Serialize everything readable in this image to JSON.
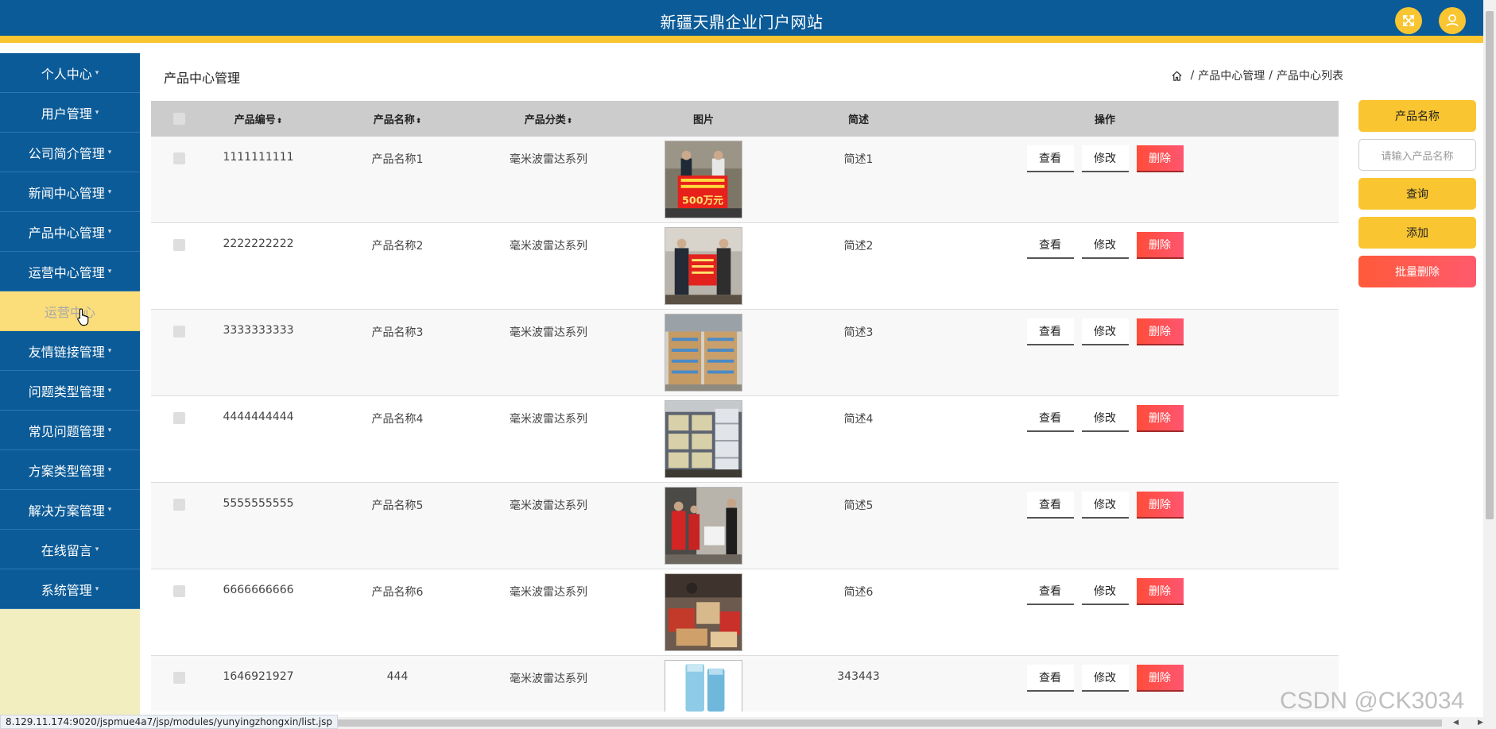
{
  "header": {
    "title": "新疆天鼎企业门户网站",
    "icons": [
      "fullscreen-icon",
      "user-icon"
    ],
    "accent": "#f9c531",
    "primary": "#0b5b98"
  },
  "sidebar": {
    "items": [
      {
        "label": "个人中心",
        "caret": "▾"
      },
      {
        "label": "用户管理",
        "caret": "▾"
      },
      {
        "label": "公司简介管理",
        "caret": "▾"
      },
      {
        "label": "新闻中心管理",
        "caret": "▾"
      },
      {
        "label": "产品中心管理",
        "caret": "▾"
      },
      {
        "label": "运营中心管理",
        "caret": "▾"
      },
      {
        "label": "运营中心",
        "caret": ""
      },
      {
        "label": "友情链接管理",
        "caret": "▾"
      },
      {
        "label": "问题类型管理",
        "caret": "▾"
      },
      {
        "label": "常见问题管理",
        "caret": "▾"
      },
      {
        "label": "方案类型管理",
        "caret": "▾"
      },
      {
        "label": "解决方案管理",
        "caret": "▾"
      },
      {
        "label": "在线留言",
        "caret": "▾"
      },
      {
        "label": "系统管理",
        "caret": "▾"
      }
    ]
  },
  "page": {
    "heading": "产品中心管理",
    "breadcrumb": {
      "home_icon": "home-icon",
      "items": [
        "产品中心管理",
        "产品中心列表"
      ],
      "sep": "/"
    }
  },
  "table": {
    "headers": {
      "id": "产品编号",
      "name": "产品名称",
      "category": "产品分类",
      "image": "图片",
      "desc": "简述",
      "ops": "操作"
    },
    "sort_icon": "⬍",
    "actions": {
      "view": "查看",
      "edit": "修改",
      "delete": "删除"
    },
    "rows": [
      {
        "id": "1111111111",
        "name": "产品名称1",
        "category": "毫米波雷达系列",
        "desc": "简述1"
      },
      {
        "id": "2222222222",
        "name": "产品名称2",
        "category": "毫米波雷达系列",
        "desc": "简述2"
      },
      {
        "id": "3333333333",
        "name": "产品名称3",
        "category": "毫米波雷达系列",
        "desc": "简述3"
      },
      {
        "id": "4444444444",
        "name": "产品名称4",
        "category": "毫米波雷达系列",
        "desc": "简述4"
      },
      {
        "id": "5555555555",
        "name": "产品名称5",
        "category": "毫米波雷达系列",
        "desc": "简述5"
      },
      {
        "id": "6666666666",
        "name": "产品名称6",
        "category": "毫米波雷达系列",
        "desc": "简述6"
      },
      {
        "id": "1646921927",
        "name": "444",
        "category": "毫米波雷达系列",
        "desc": "343443"
      }
    ]
  },
  "search": {
    "field_label": "产品名称",
    "placeholder": "请输入产品名称",
    "query": "查询",
    "add": "添加",
    "batch_delete": "批量删除"
  },
  "images": {
    "photo1_text": "500万元"
  },
  "status_url": "8.129.11.174:9020/jspmue4a7/jsp/modules/yunyingzhongxin/list.jsp",
  "watermark": "CSDN @CK3034"
}
